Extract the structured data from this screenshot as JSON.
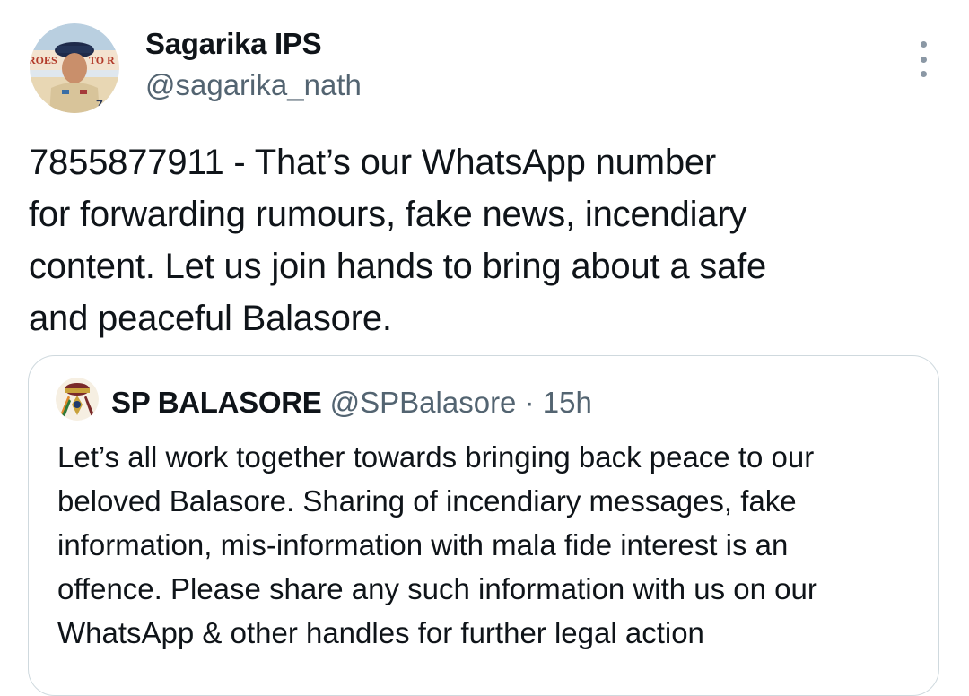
{
  "author": {
    "display_name": "Sagarika IPS",
    "handle": "@sagarika_nath",
    "avatar_icon": "profile-photo-icon",
    "avatar_banner_left": "ROES",
    "avatar_banner_right": "TO R"
  },
  "more_icon": "more-vertical-icon",
  "tweet": {
    "lines": [
      "7855877911 - That’s our WhatsApp number",
      "for forwarding rumours, fake news, incendiary",
      "content. Let us join hands to bring about a safe",
      "and peaceful Balasore."
    ]
  },
  "quoted": {
    "display_name": "SP BALASORE",
    "handle": "@SPBalasore",
    "separator": "·",
    "time": "15h",
    "avatar_icon": "police-emblem-icon",
    "lines": [
      "Let’s all work together towards bringing back peace to our",
      "beloved Balasore. Sharing of incendiary messages, fake",
      "information, mis-information with mala fide interest is an",
      "offence. Please share any such information with us on our",
      "WhatsApp & other handles for further legal action"
    ]
  },
  "colors": {
    "text_primary": "#0f1419",
    "text_secondary": "#536471",
    "border": "#cfd9de"
  }
}
